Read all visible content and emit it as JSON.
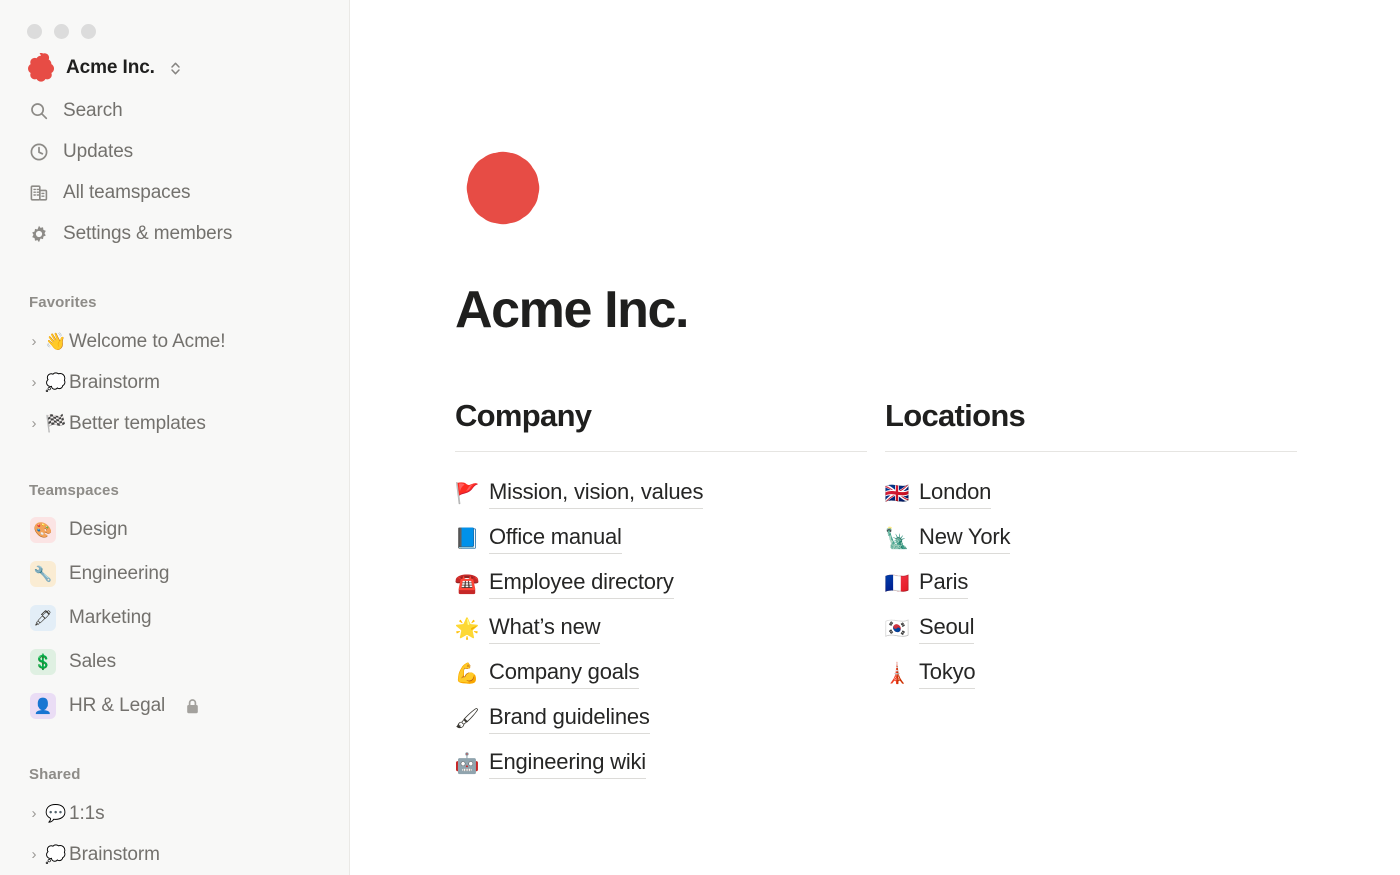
{
  "window": {
    "controls": [
      "close-dot",
      "minimize-dot",
      "maximize-dot"
    ]
  },
  "colors": {
    "brand_red": "#E74C45",
    "sidebar_bg": "#F8F8F7",
    "sidebar_text": "#73716D",
    "sidebar_section_text": "#8E8C88",
    "main_bg": "#FFFFFF",
    "heading_text": "#1F1F1E",
    "link_text": "#262625",
    "divider": "#E6E5E2",
    "link_underline": "#DCDBD8"
  },
  "sidebar": {
    "workspace": {
      "name": "Acme Inc.",
      "logo_icon": "acme-rosette-logo",
      "switcher_icon": "chevron-up-down-icon"
    },
    "nav": [
      {
        "label": "Search",
        "icon": "search-icon"
      },
      {
        "label": "Updates",
        "icon": "clock-icon"
      },
      {
        "label": "All teamspaces",
        "icon": "buildings-icon"
      },
      {
        "label": "Settings & members",
        "icon": "gear-icon"
      }
    ],
    "favorites": {
      "title": "Favorites",
      "items": [
        {
          "label": "Welcome to Acme!",
          "emoji": "👋",
          "icon": "waving-hand-icon",
          "chevron": "chevron-right-icon"
        },
        {
          "label": "Brainstorm",
          "emoji": "💭",
          "icon": "thought-balloon-icon",
          "chevron": "chevron-right-icon"
        },
        {
          "label": "Better templates",
          "emoji": "🏁",
          "icon": "chequered-flag-icon",
          "chevron": "chevron-right-icon"
        }
      ]
    },
    "teamspaces": {
      "title": "Teamspaces",
      "items": [
        {
          "label": "Design",
          "emoji": "🎨",
          "icon": "palette-icon",
          "bg": "#FBE4E4",
          "locked": false
        },
        {
          "label": "Engineering",
          "emoji": "🔧",
          "icon": "wrench-icon",
          "bg": "#FAECD3",
          "locked": false
        },
        {
          "label": "Marketing",
          "emoji": "🖋",
          "icon": "fountain-pen-icon",
          "bg": "#E3EEF7",
          "locked": false
        },
        {
          "label": "Sales",
          "emoji": "💲",
          "icon": "dollar-icon",
          "bg": "#DFF0E2",
          "locked": false
        },
        {
          "label": "HR & Legal",
          "emoji": "👤",
          "icon": "person-icon",
          "bg": "#EADDF5",
          "locked": true,
          "lock_icon": "lock-icon"
        }
      ]
    },
    "shared": {
      "title": "Shared",
      "items": [
        {
          "label": "1:1s",
          "emoji": "💬",
          "icon": "speech-balloon-icon",
          "chevron": "chevron-right-icon"
        },
        {
          "label": "Brainstorm",
          "emoji": "💭",
          "icon": "thought-balloon-icon",
          "chevron": "chevron-right-icon"
        }
      ]
    }
  },
  "page": {
    "icon": "acme-rosette-logo",
    "title": "Acme Inc.",
    "columns": [
      {
        "heading": "Company",
        "links": [
          {
            "label": "Mission, vision, values",
            "emoji": "🚩",
            "icon": "triangular-flag-icon"
          },
          {
            "label": "Office manual",
            "emoji": "📘",
            "icon": "blue-book-icon"
          },
          {
            "label": "Employee directory",
            "emoji": "☎️",
            "icon": "telephone-icon"
          },
          {
            "label": "What’s new",
            "emoji": "🌟",
            "icon": "glowing-star-icon"
          },
          {
            "label": "Company goals",
            "emoji": "💪",
            "icon": "flexed-biceps-icon"
          },
          {
            "label": "Brand guidelines",
            "emoji": "🖌",
            "icon": "paintbrush-icon"
          },
          {
            "label": "Engineering wiki",
            "emoji": "🤖",
            "icon": "robot-icon"
          }
        ]
      },
      {
        "heading": "Locations",
        "links": [
          {
            "label": "London",
            "emoji": "🇬🇧",
            "icon": "flag-uk-icon"
          },
          {
            "label": "New York",
            "emoji": "🗽",
            "icon": "statue-of-liberty-icon"
          },
          {
            "label": "Paris",
            "emoji": "🇫🇷",
            "icon": "flag-france-icon"
          },
          {
            "label": "Seoul",
            "emoji": "🇰🇷",
            "icon": "flag-south-korea-icon"
          },
          {
            "label": "Tokyo",
            "emoji": "🗼",
            "icon": "tokyo-tower-icon"
          }
        ]
      }
    ]
  }
}
